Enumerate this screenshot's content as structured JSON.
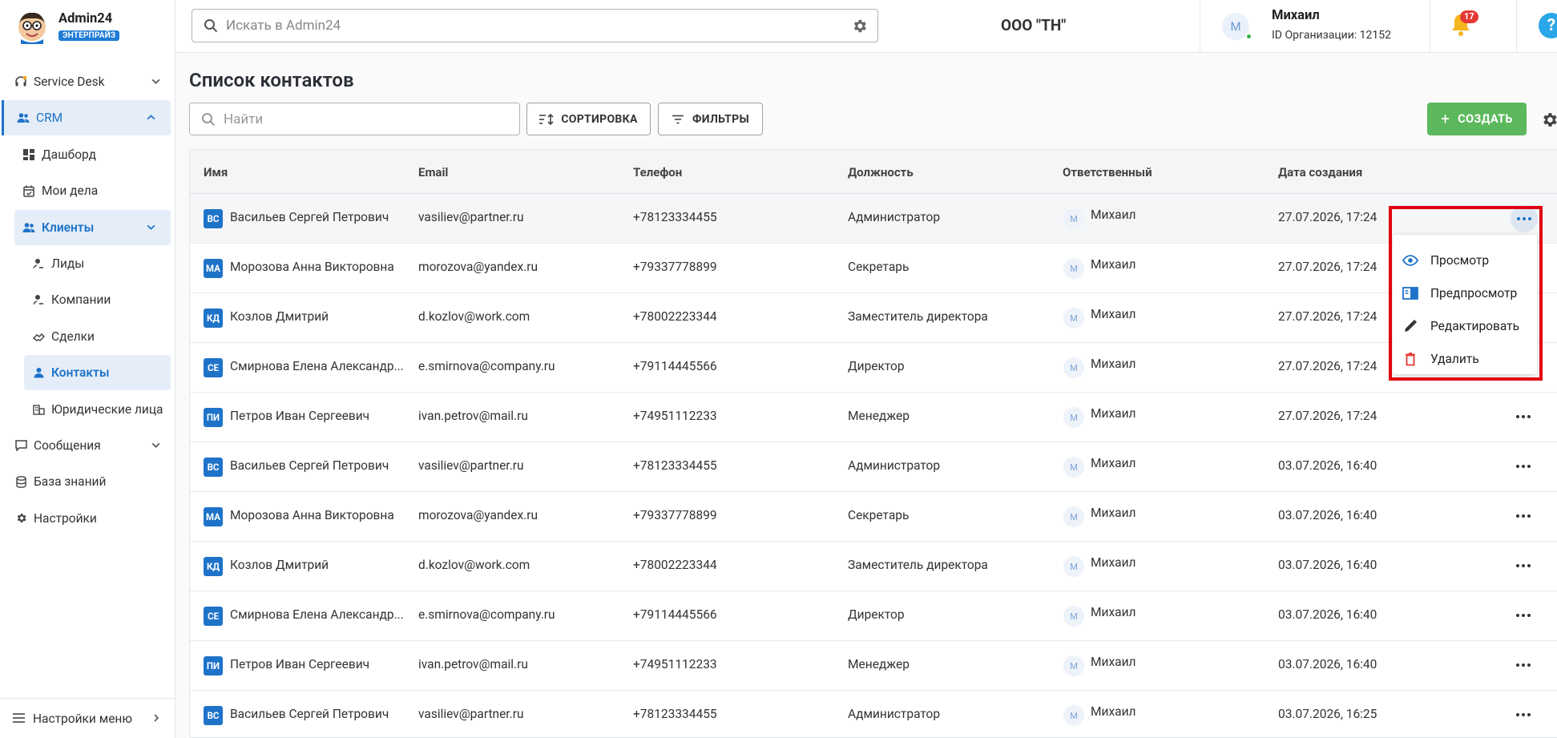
{
  "brand": {
    "name": "Admin24",
    "edition": "ЭНТЕРПРАЙЗ"
  },
  "topbar": {
    "search_placeholder": "Искать в Admin24",
    "org_name": "ООО \"ТН\"",
    "user_initial": "М",
    "user_name": "Михаил",
    "org_id": "ID Организации: 12152",
    "notifications": "17",
    "help": "?"
  },
  "sidebar": {
    "items": [
      {
        "label": "Service Desk"
      },
      {
        "label": "CRM"
      },
      {
        "label": "Дашборд"
      },
      {
        "label": "Мои дела"
      },
      {
        "label": "Клиенты"
      },
      {
        "label": "Лиды"
      },
      {
        "label": "Компании"
      },
      {
        "label": "Сделки"
      },
      {
        "label": "Контакты"
      },
      {
        "label": "Юридические лица"
      },
      {
        "label": "Сообщения"
      },
      {
        "label": "База знаний"
      },
      {
        "label": "Настройки"
      }
    ],
    "bottom": "Настройки меню"
  },
  "page": {
    "title": "Список контактов",
    "find_placeholder": "Найти",
    "sort_label": "СОРТИРОВКА",
    "filter_label": "ФИЛЬТРЫ",
    "create_label": "СОЗДАТЬ"
  },
  "table": {
    "columns": [
      "Имя",
      "Email",
      "Телефон",
      "Должность",
      "Ответственный",
      "Дата создания"
    ],
    "rows": [
      {
        "ini": "ВС",
        "name": "Васильев Сергей Петрович",
        "email": "vasiliev@partner.ru",
        "phone": "+78123334455",
        "position": "Администратор",
        "owner_ini": "М",
        "owner": "Михаил",
        "date": "27.07.2026, 17:24"
      },
      {
        "ini": "МА",
        "name": "Морозова Анна Викторовна",
        "email": "morozova@yandex.ru",
        "phone": "+79337778899",
        "position": "Секретарь",
        "owner_ini": "М",
        "owner": "Михаил",
        "date": "27.07.2026, 17:24"
      },
      {
        "ini": "КД",
        "name": "Козлов Дмитрий",
        "email": "d.kozlov@work.com",
        "phone": "+78002223344",
        "position": "Заместитель директора",
        "owner_ini": "М",
        "owner": "Михаил",
        "date": "27.07.2026, 17:24"
      },
      {
        "ini": "СЕ",
        "name": "Смирнова Елена Александр...",
        "email": "e.smirnova@company.ru",
        "phone": "+79114445566",
        "position": "Директор",
        "owner_ini": "М",
        "owner": "Михаил",
        "date": "27.07.2026, 17:24"
      },
      {
        "ini": "ПИ",
        "name": "Петров Иван Сергеевич",
        "email": "ivan.petrov@mail.ru",
        "phone": "+74951112233",
        "position": "Менеджер",
        "owner_ini": "М",
        "owner": "Михаил",
        "date": "27.07.2026, 17:24"
      },
      {
        "ini": "ВС",
        "name": "Васильев Сергей Петрович",
        "email": "vasiliev@partner.ru",
        "phone": "+78123334455",
        "position": "Администратор",
        "owner_ini": "М",
        "owner": "Михаил",
        "date": "03.07.2026, 16:40"
      },
      {
        "ini": "МА",
        "name": "Морозова Анна Викторовна",
        "email": "morozova@yandex.ru",
        "phone": "+79337778899",
        "position": "Секретарь",
        "owner_ini": "М",
        "owner": "Михаил",
        "date": "03.07.2026, 16:40"
      },
      {
        "ini": "КД",
        "name": "Козлов Дмитрий",
        "email": "d.kozlov@work.com",
        "phone": "+78002223344",
        "position": "Заместитель директора",
        "owner_ini": "М",
        "owner": "Михаил",
        "date": "03.07.2026, 16:40"
      },
      {
        "ini": "СЕ",
        "name": "Смирнова Елена Александр...",
        "email": "e.smirnova@company.ru",
        "phone": "+79114445566",
        "position": "Директор",
        "owner_ini": "М",
        "owner": "Михаил",
        "date": "03.07.2026, 16:40"
      },
      {
        "ini": "ПИ",
        "name": "Петров Иван Сергеевич",
        "email": "ivan.petrov@mail.ru",
        "phone": "+74951112233",
        "position": "Менеджер",
        "owner_ini": "М",
        "owner": "Михаил",
        "date": "03.07.2026, 16:40"
      },
      {
        "ini": "ВС",
        "name": "Васильев Сергей Петрович",
        "email": "vasiliev@partner.ru",
        "phone": "+78123334455",
        "position": "Администратор",
        "owner_ini": "М",
        "owner": "Михаил",
        "date": "03.07.2026, 16:25"
      }
    ]
  },
  "context_menu": {
    "items": [
      "Просмотр",
      "Предпросмотр",
      "Редактировать",
      "Удалить"
    ],
    "colors": {
      "view": "#1e73c9",
      "edit": "#333333",
      "delete": "#e53935"
    }
  },
  "colors": {
    "accent": "#1e73c9",
    "create": "#5cb85c",
    "highlight": "#e00010"
  }
}
